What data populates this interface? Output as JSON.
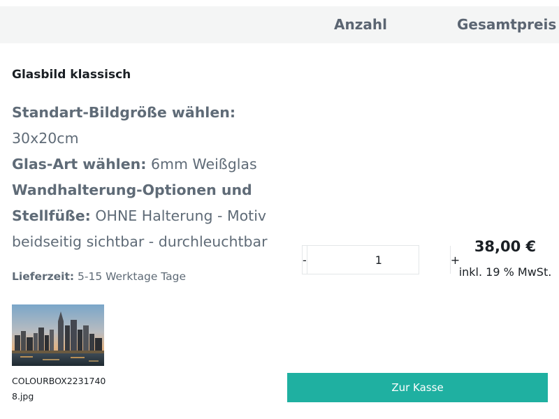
{
  "header": {
    "quantity_label": "Anzahl",
    "total_label": "Gesamtpreis"
  },
  "product": {
    "title": "Glasbild klassisch",
    "options": [
      {
        "label": "Standart-Bildgröße wählen:",
        "value": "30x20cm"
      },
      {
        "label": "Glas-Art wählen:",
        "value": "6mm Weißglas"
      },
      {
        "label": "Wandhalterung-Optionen und Stellfüße:",
        "value": "OHNE Halterung - Motiv beidseitig sichtbar - durchleuchtbar"
      }
    ],
    "delivery_label": "Lieferzeit:",
    "delivery_value": "5-15 Werktage Tage",
    "filename": "COLOURBOX22317408.jpg"
  },
  "quantity": {
    "minus_label": "-",
    "value": "1",
    "plus_label": "+"
  },
  "price": {
    "amount": "38,00 €",
    "tax_note": "inkl. 19 % MwSt."
  },
  "checkout": {
    "label": "Zur Kasse",
    "color": "#1fb0a1"
  }
}
